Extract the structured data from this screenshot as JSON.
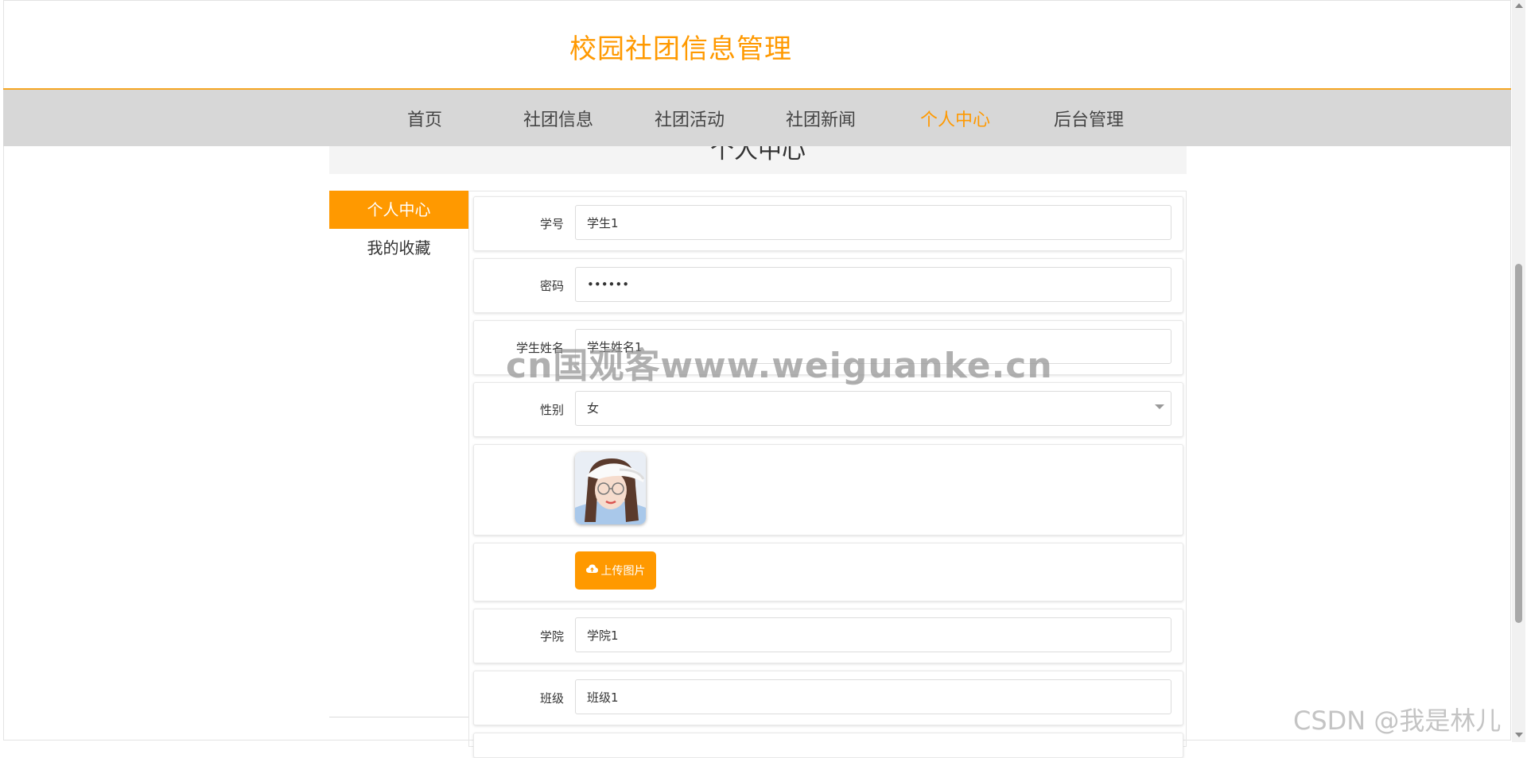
{
  "site": {
    "title": "校园社团信息管理"
  },
  "nav": {
    "items": [
      {
        "label": "首页"
      },
      {
        "label": "社团信息"
      },
      {
        "label": "社团活动"
      },
      {
        "label": "社团新闻"
      },
      {
        "label": "个人中心",
        "active": true
      },
      {
        "label": "后台管理"
      }
    ]
  },
  "page": {
    "subtitle": "个人中心"
  },
  "sidebar": {
    "items": [
      {
        "label": "个人中心",
        "active": true
      },
      {
        "label": "我的收藏"
      }
    ]
  },
  "form": {
    "student_id": {
      "label": "学号",
      "value": "学生1"
    },
    "password": {
      "label": "密码",
      "value": "123456"
    },
    "student_name": {
      "label": "学生姓名",
      "value": "学生姓名1"
    },
    "gender": {
      "label": "性别",
      "value": "女"
    },
    "upload_button": {
      "label": "上传图片",
      "icon": "cloud-upload-icon"
    },
    "college": {
      "label": "学院",
      "value": "学院1"
    },
    "class_name": {
      "label": "班级",
      "value": "班级1"
    }
  },
  "overlays": {
    "watermark": "cn国观客www.weiguanke.cn",
    "csdn_watermark": "CSDN @我是林儿"
  },
  "colors": {
    "accent": "#ff9900",
    "navbar": "#d7d7d7"
  }
}
